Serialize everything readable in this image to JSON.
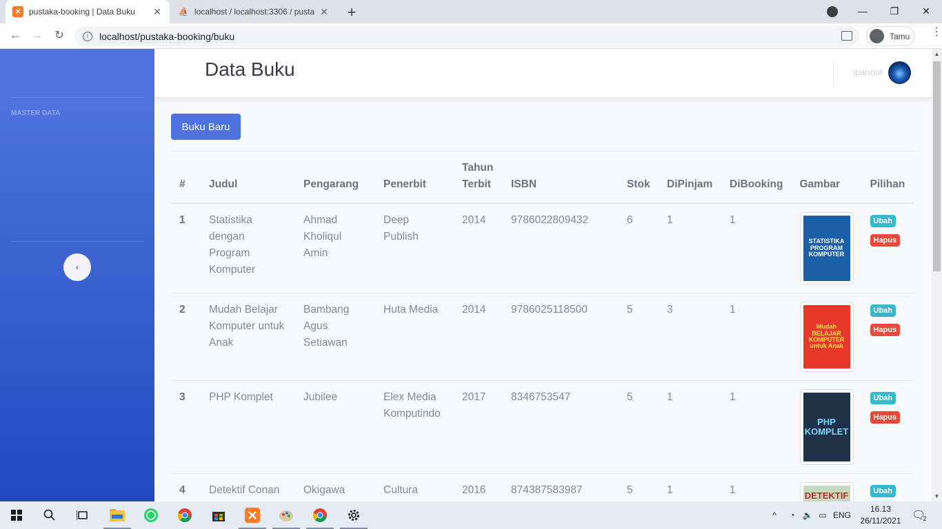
{
  "browser": {
    "tabs": [
      {
        "title": "pustaka-booking | Data Buku",
        "active": true
      },
      {
        "title": "localhost / localhost:3306 / pusta",
        "active": false
      }
    ],
    "new_tab": "+",
    "window_controls": [
      "—",
      "❐",
      "✕"
    ],
    "url": "localhost/pustaka-booking/buku",
    "profile_label": "Tamu"
  },
  "sidebar": {
    "heading": "MASTER DATA",
    "toggle_icon": "chevron-left-icon"
  },
  "topbar": {
    "page_title": "Data Buku",
    "user_name": "ipannur"
  },
  "actions": {
    "new_book_label": "Buku Baru"
  },
  "table": {
    "headers": [
      "#",
      "Judul",
      "Pengarang",
      "Penerbit",
      "Tahun Terbit",
      "ISBN",
      "Stok",
      "DiPinjam",
      "DiBooking",
      "Gambar",
      "Pilihan"
    ],
    "edit_label": "Ubah",
    "delete_label": "Hapus",
    "rows": [
      {
        "no": "1",
        "judul": "Statistika dengan Program Komputer",
        "pengarang": "Ahmad Kholiqul Amin",
        "penerbit": "Deep Publish",
        "tahun": "2014",
        "isbn": "9786022809432",
        "stok": "6",
        "dipinjam": "1",
        "dibooking": "1",
        "cover": {
          "lines": [
            "STATISTIKA",
            "PROGRAM",
            "KOMPUTER"
          ],
          "bg": "#1a5fa8",
          "fg": "#ffffff"
        }
      },
      {
        "no": "2",
        "judul": "Mudah Belajar Komputer untuk Anak",
        "pengarang": "Bambang Agus Setiawan",
        "penerbit": "Huta Media",
        "tahun": "2014",
        "isbn": "9786025118500",
        "stok": "5",
        "dipinjam": "3",
        "dibooking": "1",
        "cover": {
          "lines": [
            "Mudah",
            "BELAJAR",
            "KOMPUTER",
            "untuk Anak"
          ],
          "bg": "#e8372b",
          "fg": "#ffe14a"
        }
      },
      {
        "no": "3",
        "judul": "PHP Komplet",
        "pengarang": "Jubilee",
        "penerbit": "Elex Media Komputindo",
        "tahun": "2017",
        "isbn": "8346753547",
        "stok": "5",
        "dipinjam": "1",
        "dibooking": "1",
        "cover": {
          "lines": [
            "PHP",
            "KOMPLET"
          ],
          "bg": "#1e3147",
          "fg": "#7fd4ff"
        }
      },
      {
        "no": "4",
        "judul": "Detektif Conan",
        "pengarang": "Okigawa",
        "penerbit": "Cultura",
        "tahun": "2016",
        "isbn": "874387583987",
        "stok": "5",
        "dipinjam": "1",
        "dibooking": "1",
        "cover": {
          "lines": [
            "DETEKTIF"
          ],
          "bg": "#c7d9c2",
          "fg": "#b03020"
        }
      }
    ]
  },
  "taskbar": {
    "language": "ENG",
    "time": "16.13",
    "date": "26/11/2021",
    "notification_count": "2"
  },
  "colors": {
    "primary": "#4e73df",
    "info": "#36b9cc",
    "danger": "#e74a3b"
  }
}
